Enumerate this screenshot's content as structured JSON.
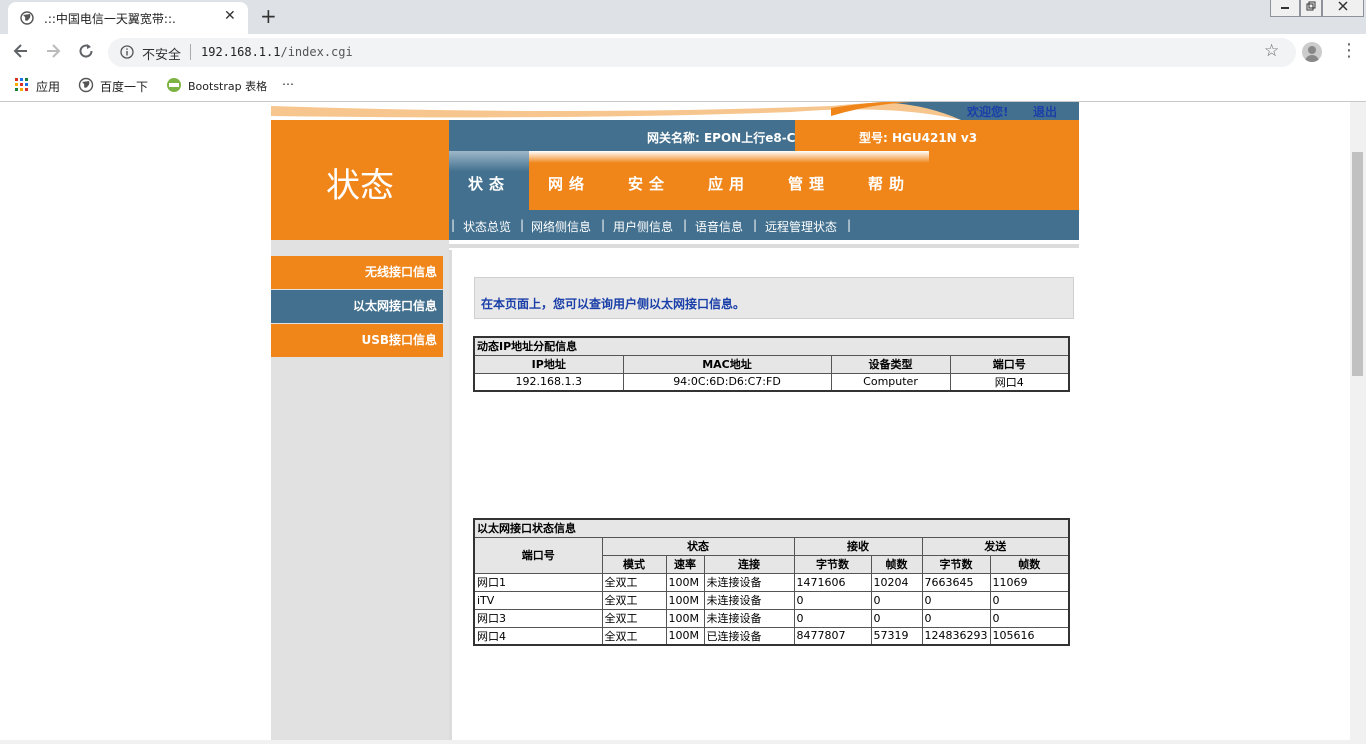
{
  "browser": {
    "tab_title": ".::中国电信一天翼宽带::.",
    "tab_close": "✕",
    "new_tab": "+",
    "security_label": "不安全",
    "url_host": "192.168.1.1",
    "url_path": "/index.cgi",
    "bookmarks": [
      {
        "label": "应用"
      },
      {
        "label": "百度一下"
      },
      {
        "label": "Bootstrap 表格"
      }
    ],
    "bookmarks_more": "⋯"
  },
  "header": {
    "welcome": "欢迎您!",
    "logout": "退出",
    "section_title": "状态",
    "gateway_name": "网关名称: EPON上行e8-C",
    "model": "型号: HGU421N v3"
  },
  "main_nav": [
    {
      "label": "状态"
    },
    {
      "label": "网络"
    },
    {
      "label": "安全"
    },
    {
      "label": "应用"
    },
    {
      "label": "管理"
    },
    {
      "label": "帮助"
    }
  ],
  "sub_nav": [
    {
      "label": "状态总览"
    },
    {
      "label": "网络侧信息"
    },
    {
      "label": "用户侧信息"
    },
    {
      "label": "语音信息"
    },
    {
      "label": "远程管理状态"
    }
  ],
  "sidebar": [
    {
      "label": "无线接口信息"
    },
    {
      "label": "以太网接口信息"
    },
    {
      "label": "USB接口信息"
    }
  ],
  "notice": "在本页面上，您可以查询用户侧以太网接口信息。",
  "dhcp_table": {
    "caption": "动态IP地址分配信息",
    "headers": [
      "IP地址",
      "MAC地址",
      "设备类型",
      "端口号"
    ],
    "rows": [
      [
        "192.168.1.3",
        "94:0C:6D:D6:C7:FD",
        "Computer",
        "网口4"
      ]
    ]
  },
  "eth_table": {
    "caption": "以太网接口状态信息",
    "port_header": "端口号",
    "group_status": "状态",
    "group_rx": "接收",
    "group_tx": "发送",
    "sub_headers": [
      "模式",
      "速率",
      "连接",
      "字节数",
      "帧数",
      "字节数",
      "帧数"
    ],
    "rows": [
      [
        "网口1",
        "全双工",
        "100M",
        "未连接设备",
        "1471606",
        "10204",
        "7663645",
        "11069"
      ],
      [
        "iTV",
        "全双工",
        "100M",
        "未连接设备",
        "0",
        "0",
        "0",
        "0"
      ],
      [
        "网口3",
        "全双工",
        "100M",
        "未连接设备",
        "0",
        "0",
        "0",
        "0"
      ],
      [
        "网口4",
        "全双工",
        "100M",
        "已连接设备",
        "8477807",
        "57319",
        "124836293",
        "105616"
      ]
    ]
  }
}
